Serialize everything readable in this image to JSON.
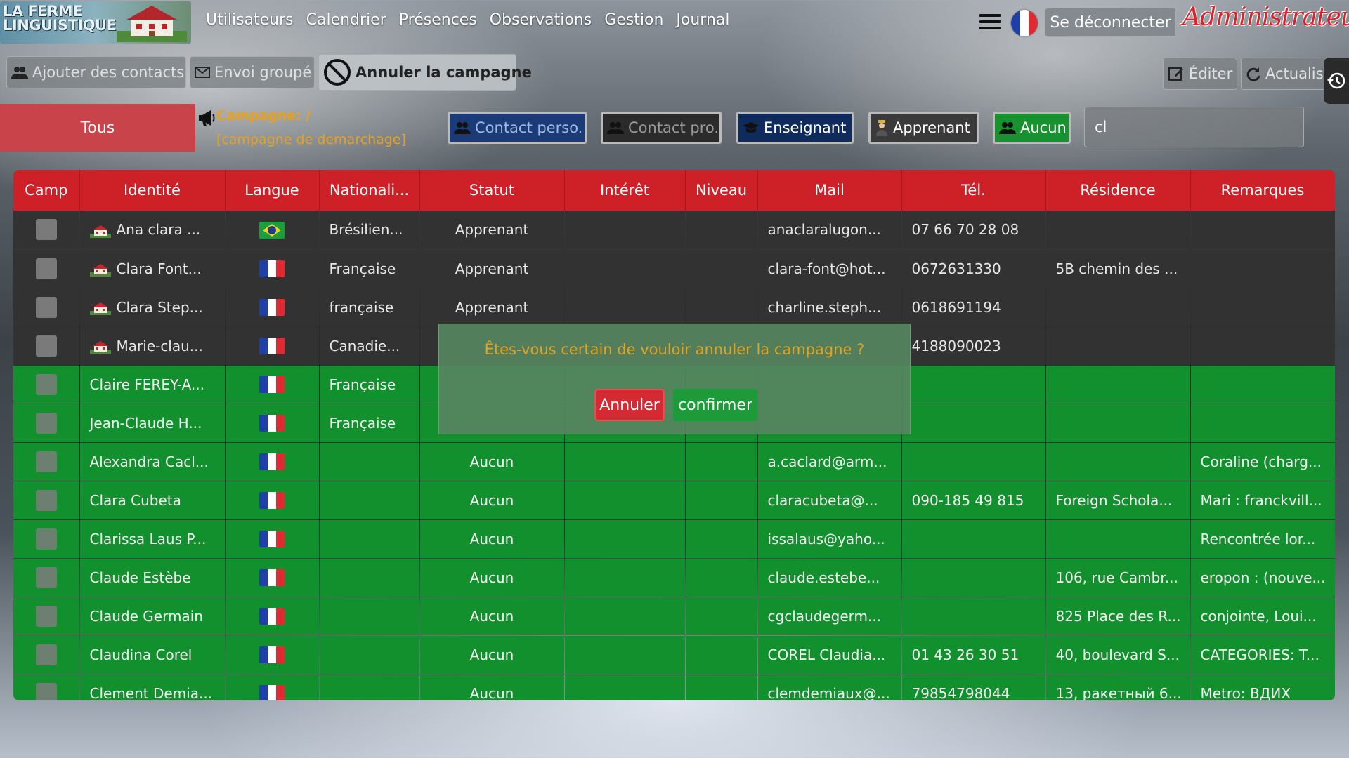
{
  "nav": {
    "logo_text": "LA FERME\nLINGUISTIQUE",
    "links": [
      "Utilisateurs",
      "Calendrier",
      "Présences",
      "Observations",
      "Gestion",
      "Journal"
    ],
    "logout_label": "Se déconnecter",
    "role_label": "Administrateur",
    "language_flag": "fr"
  },
  "toolbar": {
    "add_contacts_label": "Ajouter des contacts",
    "bulk_send_label": "Envoi groupé",
    "cancel_campaign_label": "Annuler la campagne",
    "edit_label": "Éditer",
    "refresh_label": "Actualis"
  },
  "filters": {
    "all_label": "Tous",
    "campaign_line1": "Campagne:  /",
    "campaign_line2": "[campagne de demarchage]",
    "buttons": [
      {
        "label": "Contact perso.",
        "bg": "#1a3a78",
        "color": "#9fb6df"
      },
      {
        "label": "Contact pro.",
        "bg": "#2b2b2b",
        "color": "#9a9a9a"
      },
      {
        "label": "Enseignant",
        "bg": "#0f2a5c",
        "color": "#ffffff"
      },
      {
        "label": "Apprenant",
        "bg": "#3a3a3a",
        "color": "#ffffff"
      },
      {
        "label": "Aucun",
        "bg": "#18922f",
        "color": "#ffffff"
      }
    ],
    "search_value": "cl"
  },
  "table": {
    "headers": [
      "Camp",
      "Identité",
      "Langue",
      "Nationali...",
      "Statut",
      "Intérêt",
      "Niveau",
      "Mail",
      "Tél.",
      "Résidence",
      "Remarques"
    ],
    "rows": [
      {
        "style": "dark",
        "house": true,
        "identity": "Ana clara ...",
        "flag": "br",
        "nationality": "Brésilien...",
        "status": "Apprenant",
        "interest": "",
        "level": "",
        "mail": "anaclaralugon...",
        "phone": "07 66 70 28 08",
        "residence": "",
        "remarks": ""
      },
      {
        "style": "dark",
        "house": true,
        "identity": "Clara Font...",
        "flag": "fr",
        "nationality": "Française",
        "status": "Apprenant",
        "interest": "",
        "level": "",
        "mail": "clara-font@hot...",
        "phone": "0672631330",
        "residence": "5B chemin des ...",
        "remarks": ""
      },
      {
        "style": "dark",
        "house": true,
        "identity": "Clara Step...",
        "flag": "fr",
        "nationality": "française",
        "status": "Apprenant",
        "interest": "",
        "level": "",
        "mail": "charline.steph...",
        "phone": "0618691194",
        "residence": "",
        "remarks": ""
      },
      {
        "style": "dark",
        "house": true,
        "identity": "Marie-clau...",
        "flag": "fr",
        "nationality": "Canadie...",
        "status": "",
        "interest": "",
        "level": "",
        "mail": "",
        "phone": "4188090023",
        "residence": "",
        "remarks": ""
      },
      {
        "style": "green",
        "house": false,
        "identity": "Claire FEREY-A...",
        "flag": "fr",
        "nationality": "Française",
        "status": "",
        "interest": "",
        "level": "",
        "mail": "",
        "phone": "",
        "residence": "",
        "remarks": ""
      },
      {
        "style": "green",
        "house": false,
        "identity": "Jean-Claude H...",
        "flag": "fr",
        "nationality": "Française",
        "status": "",
        "interest": "",
        "level": "",
        "mail": "",
        "phone": "",
        "residence": "",
        "remarks": ""
      },
      {
        "style": "green",
        "house": false,
        "identity": "Alexandra Cacl...",
        "flag": "fr",
        "nationality": "",
        "status": "Aucun",
        "interest": "",
        "level": "",
        "mail": "a.caclard@arm...",
        "phone": "",
        "residence": "",
        "remarks": "Coraline (charg..."
      },
      {
        "style": "green",
        "house": false,
        "identity": "Clara Cubeta",
        "flag": "fr",
        "nationality": "",
        "status": "Aucun",
        "interest": "",
        "level": "",
        "mail": "claracubeta@...",
        "phone": "090-185 49 815",
        "residence": "Foreign Schola...",
        "remarks": "Mari : franckvill..."
      },
      {
        "style": "green",
        "house": false,
        "identity": "Clarissa Laus P...",
        "flag": "fr",
        "nationality": "",
        "status": "Aucun",
        "interest": "",
        "level": "",
        "mail": "issalaus@yaho...",
        "phone": "",
        "residence": "",
        "remarks": "Rencontrée lor..."
      },
      {
        "style": "green",
        "house": false,
        "identity": "Claude Estèbe",
        "flag": "fr",
        "nationality": "",
        "status": "Aucun",
        "interest": "",
        "level": "",
        "mail": "claude.estebe...",
        "phone": "",
        "residence": "106, rue Cambr...",
        "remarks": "eropon : (nouve..."
      },
      {
        "style": "green",
        "house": false,
        "identity": "Claude Germain",
        "flag": "fr",
        "nationality": "",
        "status": "Aucun",
        "interest": "",
        "level": "",
        "mail": "cgclaudegerm...",
        "phone": "",
        "residence": "825 Place des R...",
        "remarks": "conjointe, Loui..."
      },
      {
        "style": "green",
        "house": false,
        "identity": "Claudina Corel",
        "flag": "fr",
        "nationality": "",
        "status": "Aucun",
        "interest": "",
        "level": "",
        "mail": "COREL Claudia...",
        "phone": "01 43 26 30 51",
        "residence": "40, boulevard S...",
        "remarks": "CATEGORIES: T..."
      },
      {
        "style": "green",
        "house": false,
        "identity": "Clement Demia...",
        "flag": "fr",
        "nationality": "",
        "status": "Aucun",
        "interest": "",
        "level": "",
        "mail": "clemdemiaux@...",
        "phone": "79854798044",
        "residence": "13, ракетный 6...",
        "remarks": "Metro: ВДИХ"
      }
    ]
  },
  "dialog": {
    "message": "Êtes-vous certain de vouloir annuler la campagne ?",
    "cancel_label": "Annuler",
    "confirm_label": "confirmer"
  }
}
